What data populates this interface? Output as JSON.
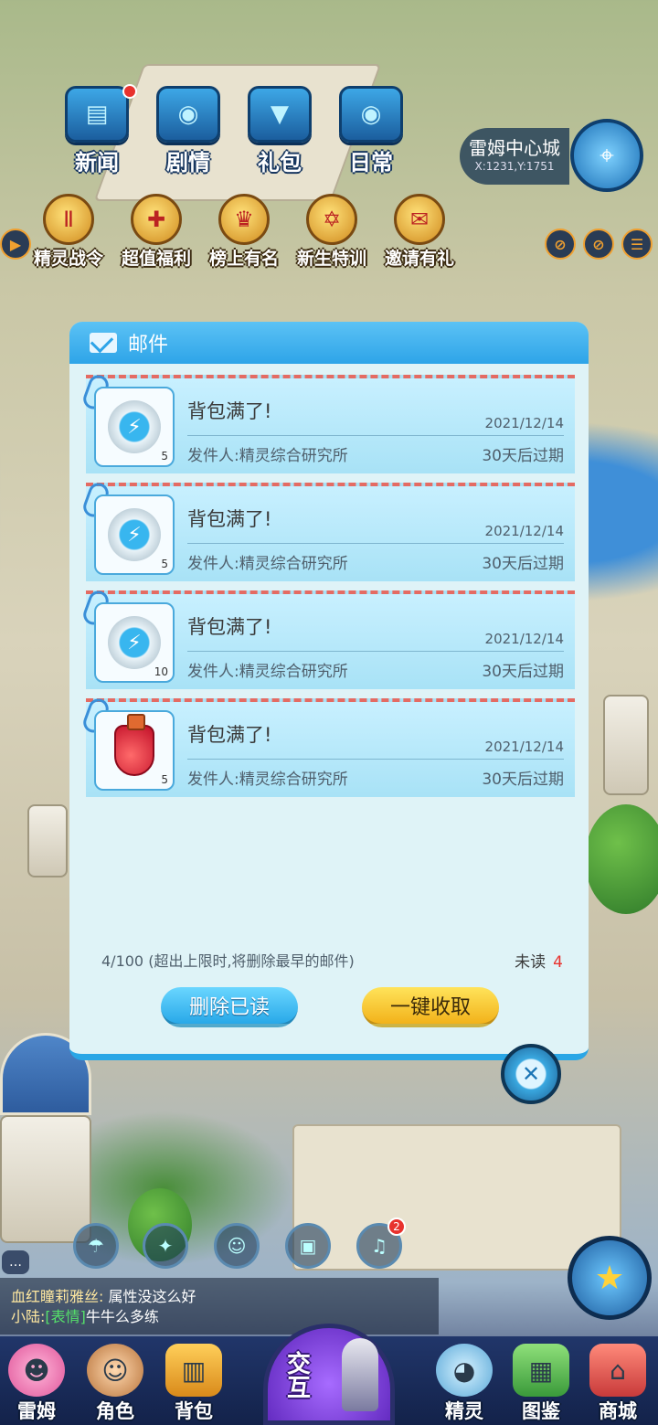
{
  "top_menu": [
    {
      "label": "新闻",
      "icon": "newspaper-icon",
      "has_dot": true
    },
    {
      "label": "剧情",
      "icon": "story-book-icon",
      "has_dot": false
    },
    {
      "label": "礼包",
      "icon": "gift-box-icon",
      "has_dot": false
    },
    {
      "label": "日常",
      "icon": "calendar-icon",
      "has_dot": false
    }
  ],
  "activities": [
    {
      "label": "精灵战令",
      "icon": "battle-pass-icon"
    },
    {
      "label": "超值福利",
      "icon": "welfare-gift-icon"
    },
    {
      "label": "榜上有名",
      "icon": "trophy-icon"
    },
    {
      "label": "新生特训",
      "icon": "star-badge-icon"
    },
    {
      "label": "邀请有礼",
      "icon": "invite-envelope-icon"
    }
  ],
  "location": {
    "name": "雷姆中心城",
    "coords": "X:1231,Y:1751"
  },
  "mail": {
    "title": "邮件",
    "items": [
      {
        "title": "背包满了!",
        "date": "2021/12/14",
        "sender": "发件人:精灵综合研究所",
        "expiry": "30天后过期",
        "item": "gear-core",
        "qty": "5"
      },
      {
        "title": "背包满了!",
        "date": "2021/12/14",
        "sender": "发件人:精灵综合研究所",
        "expiry": "30天后过期",
        "item": "gear-core",
        "qty": "5"
      },
      {
        "title": "背包满了!",
        "date": "2021/12/14",
        "sender": "发件人:精灵综合研究所",
        "expiry": "30天后过期",
        "item": "gear-core",
        "qty": "10"
      },
      {
        "title": "背包满了!",
        "date": "2021/12/14",
        "sender": "发件人:精灵综合研究所",
        "expiry": "30天后过期",
        "item": "red-potion",
        "qty": "5"
      }
    ],
    "capacity_note": "4/100 (超出上限时,将删除最早的邮件)",
    "unread_label": "未读",
    "unread_count": "4",
    "delete_read_label": "删除已读",
    "collect_all_label": "一键收取"
  },
  "chat": [
    {
      "name": "血红瞳莉雅丝:",
      "tag": "",
      "text": "属性没这么好"
    },
    {
      "name": "小陆:",
      "tag": "[表情]",
      "text": "牛牛么多练"
    }
  ],
  "quick_badge": "2",
  "bottom_tabs": [
    {
      "label": "雷姆",
      "icon": "pink-monster-icon"
    },
    {
      "label": "角色",
      "icon": "character-icon"
    },
    {
      "label": "背包",
      "icon": "backpack-icon"
    },
    {
      "label": "精灵",
      "icon": "spirit-icon"
    },
    {
      "label": "图鉴",
      "icon": "encyclopedia-icon"
    },
    {
      "label": "商城",
      "icon": "shop-icon"
    }
  ],
  "center_tab": {
    "label": "交互"
  }
}
